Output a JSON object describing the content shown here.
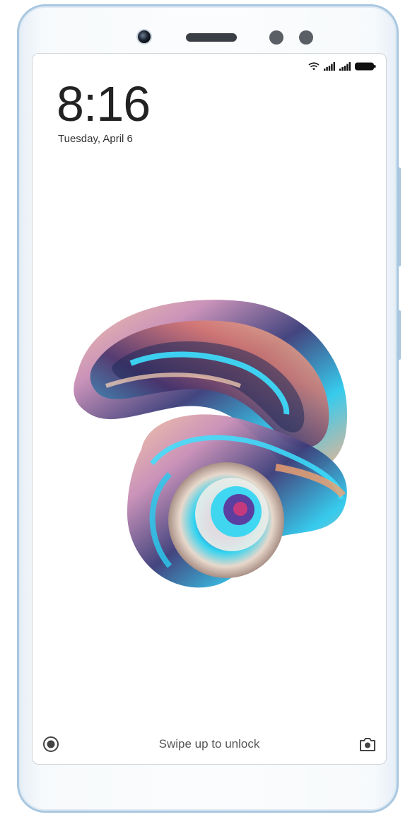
{
  "lock_screen": {
    "time": "8:16",
    "date": "Tuesday, April 6",
    "unlock_hint": "Swipe up to unlock"
  },
  "status_bar": {
    "icons": [
      "wifi-icon",
      "signal-icon",
      "signal-icon",
      "battery-icon"
    ]
  },
  "shortcuts": {
    "left_icon": "remote-control-icon",
    "right_icon": "camera-icon"
  },
  "colors": {
    "frame": "#a9c7e0",
    "text": "#222222"
  }
}
